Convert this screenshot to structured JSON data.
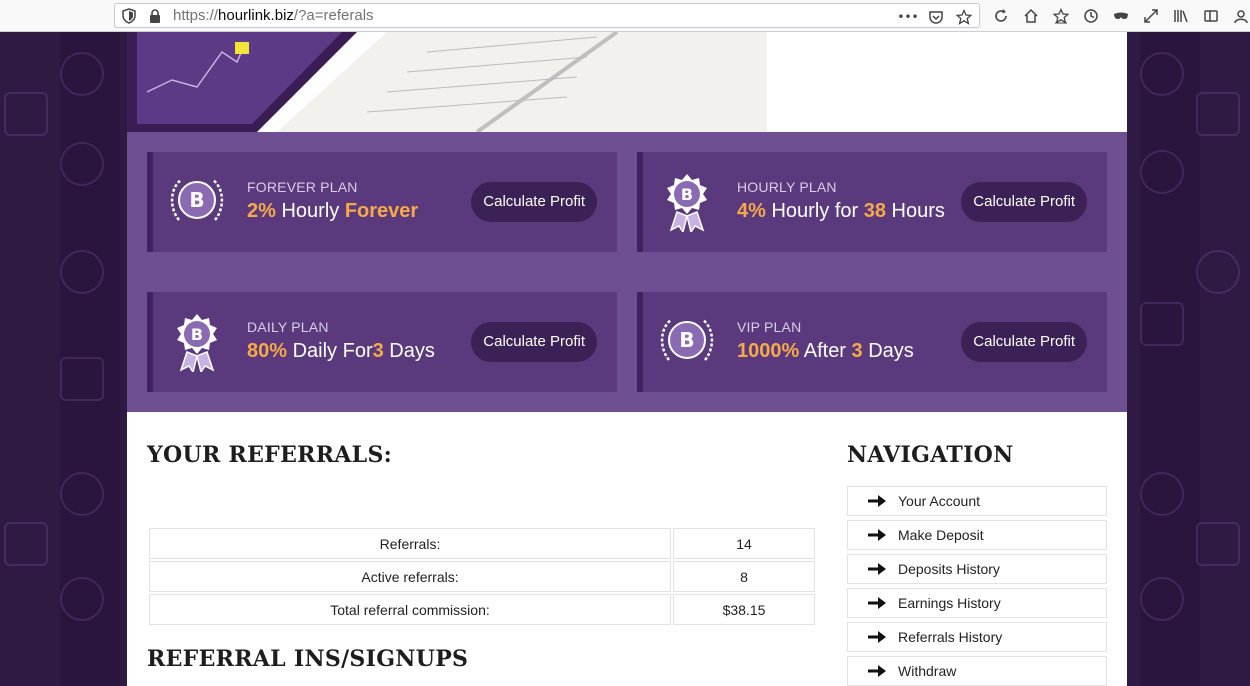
{
  "browser": {
    "url_prefix": "https://",
    "url_host": "hourlink.biz",
    "url_path": "/?a=referals",
    "overflow_menu": "•••"
  },
  "plans": [
    {
      "name": "FOREVER PLAN",
      "pct": "2%",
      "mid": " Hourly ",
      "num": "Forever",
      "tail": "",
      "button": "Calculate Profit",
      "badge": "wreath"
    },
    {
      "name": "HOURLY PLAN",
      "pct": "4%",
      "mid": " Hourly for ",
      "num": "38",
      "tail": " Hours",
      "button": "Calculate Profit",
      "badge": "ribbon"
    },
    {
      "name": "DAILY PLAN",
      "pct": "80%",
      "mid": " Daily For",
      "num": "3",
      "tail": " Days",
      "button": "Calculate Profit",
      "badge": "ribbon"
    },
    {
      "name": "VIP PLAN",
      "pct": "1000%",
      "mid": " After ",
      "num": "3",
      "tail": " Days",
      "button": "Calculate Profit",
      "badge": "wreath"
    }
  ],
  "referrals": {
    "title": "YOUR REFERRALS:",
    "rows": [
      {
        "label": "Referrals:",
        "value": "14"
      },
      {
        "label": "Active referrals:",
        "value": "8"
      },
      {
        "label": "Total referral commission:",
        "value": "$38.15"
      }
    ],
    "signups_title": "REFERRAL INS/SIGNUPS"
  },
  "navigation": {
    "title": "NAVIGATION",
    "items": [
      "Your Account",
      "Make Deposit",
      "Deposits History",
      "Earnings History",
      "Referrals History",
      "Withdraw"
    ]
  },
  "colors": {
    "accent": "#f6a94a",
    "plan_bg": "#5a3a7c",
    "section_bg": "#6e4f91",
    "button_bg": "#3c2156"
  }
}
